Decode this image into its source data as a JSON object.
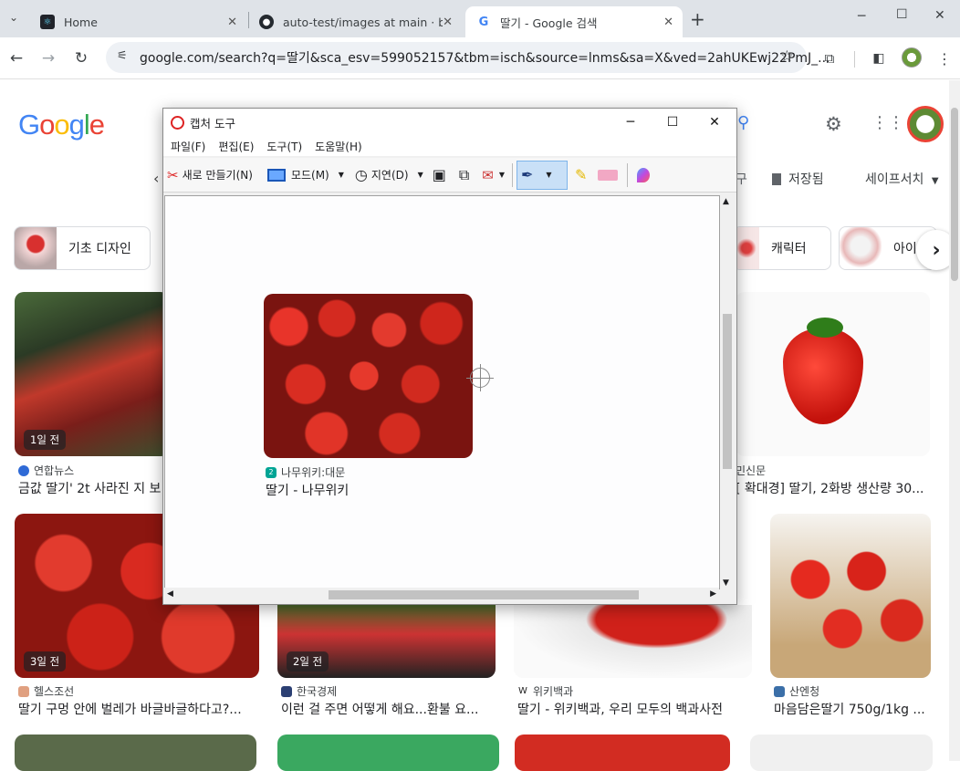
{
  "browser": {
    "tabs": [
      {
        "title": "Home",
        "icon": "react-icon"
      },
      {
        "title": "auto-test/images at main · blo",
        "icon": "github-icon"
      },
      {
        "title": "딸기 - Google 검색",
        "icon": "google-icon",
        "active": true
      }
    ],
    "url": "google.com/search?q=딸기&sca_esv=599052157&tbm=isch&source=lnms&sa=X&ved=2ahUKEwj22PmJ_..."
  },
  "google": {
    "logo": "Google",
    "nav_tail": "구",
    "saved_label": "저장됨",
    "safesearch_label": "세이프서치",
    "chips": [
      "기초 디자인",
      "캐릭터",
      "아이"
    ],
    "results": [
      {
        "source": "연합뉴스",
        "title": "금값 딸기' 2t 사라진 지 보",
        "badge": "1일 전"
      },
      {
        "source": "나무위키:대문",
        "title": "딸기 - 나무위키"
      },
      {
        "source": "민신문",
        "title": "[ 확대경] 딸기, 2화방 생산량 30..."
      },
      {
        "source": "헬스조선",
        "title": "딸기 구멍 안에 벌레가 바글바글하다고?...",
        "badge": "3일 전"
      },
      {
        "source": "한국경제",
        "title": "이런 걸 주면 어떻게 해요...환불 요...",
        "badge": "2일 전"
      },
      {
        "source": "위키백과",
        "title": "딸기 - 위키백과, 우리 모두의 백과사전"
      },
      {
        "source": "산엔청",
        "title": "마음담은딸기 750g/1kg ..."
      }
    ]
  },
  "snip": {
    "title": "캡처 도구",
    "menu": [
      "파일(F)",
      "편집(E)",
      "도구(T)",
      "도움말(H)"
    ],
    "new_label": "새로 만들기(N)",
    "mode_label": "모드(M)",
    "delay_label": "지연(D)",
    "controls": {
      "minimize": "─",
      "maximize": "☐",
      "close": "✕"
    }
  }
}
